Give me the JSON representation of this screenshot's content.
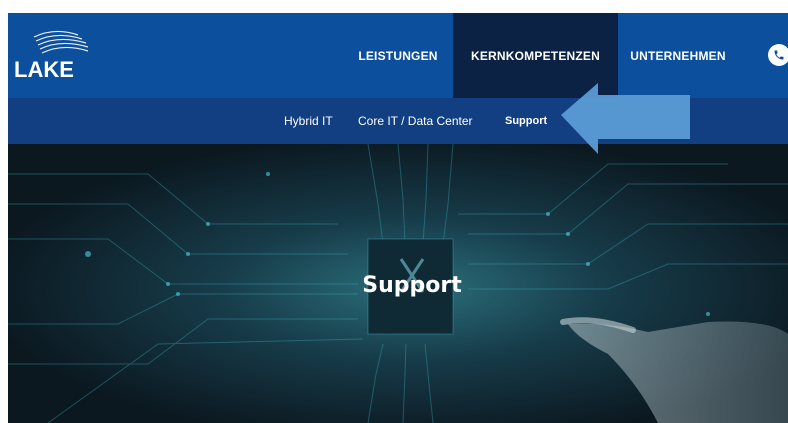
{
  "logo": {
    "text": "LAKE"
  },
  "nav": {
    "items": [
      {
        "label": "LEISTUNGEN",
        "active": false
      },
      {
        "label": "KERNKOMPETENZEN",
        "active": true
      },
      {
        "label": "UNTERNEHMEN",
        "active": false
      }
    ],
    "phone_icon": "phone-icon"
  },
  "subnav": {
    "items": [
      {
        "label": "Hybrid IT"
      },
      {
        "label": "Core IT / Data Center"
      },
      {
        "label": "Support",
        "active": true
      }
    ]
  },
  "hero": {
    "title": "Support"
  },
  "colors": {
    "nav_bg": "#0c4f9c",
    "nav_active_bg": "#0b2244",
    "subnav_bg": "#123f82",
    "arrow": "#5b9bd5"
  }
}
